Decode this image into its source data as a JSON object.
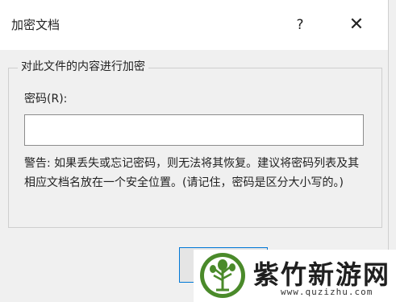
{
  "window": {
    "title": "加密文档",
    "help_glyph": "?",
    "close_glyph": "✕"
  },
  "group": {
    "title": "对此文件的内容进行加密"
  },
  "password": {
    "label": "密码(R):",
    "value": ""
  },
  "warning": {
    "text": "警告: 如果丢失或忘记密码，则无法将其恢复。建议将密码列表及其相应文档名放在一个安全位置。(请记住，密码是区分大小写的。)"
  },
  "watermark": {
    "name": "紫竹新游网",
    "url": "www.quzizhu.com"
  },
  "colors": {
    "accent": "#0078d7",
    "logo_green": "#4a8a2a"
  }
}
